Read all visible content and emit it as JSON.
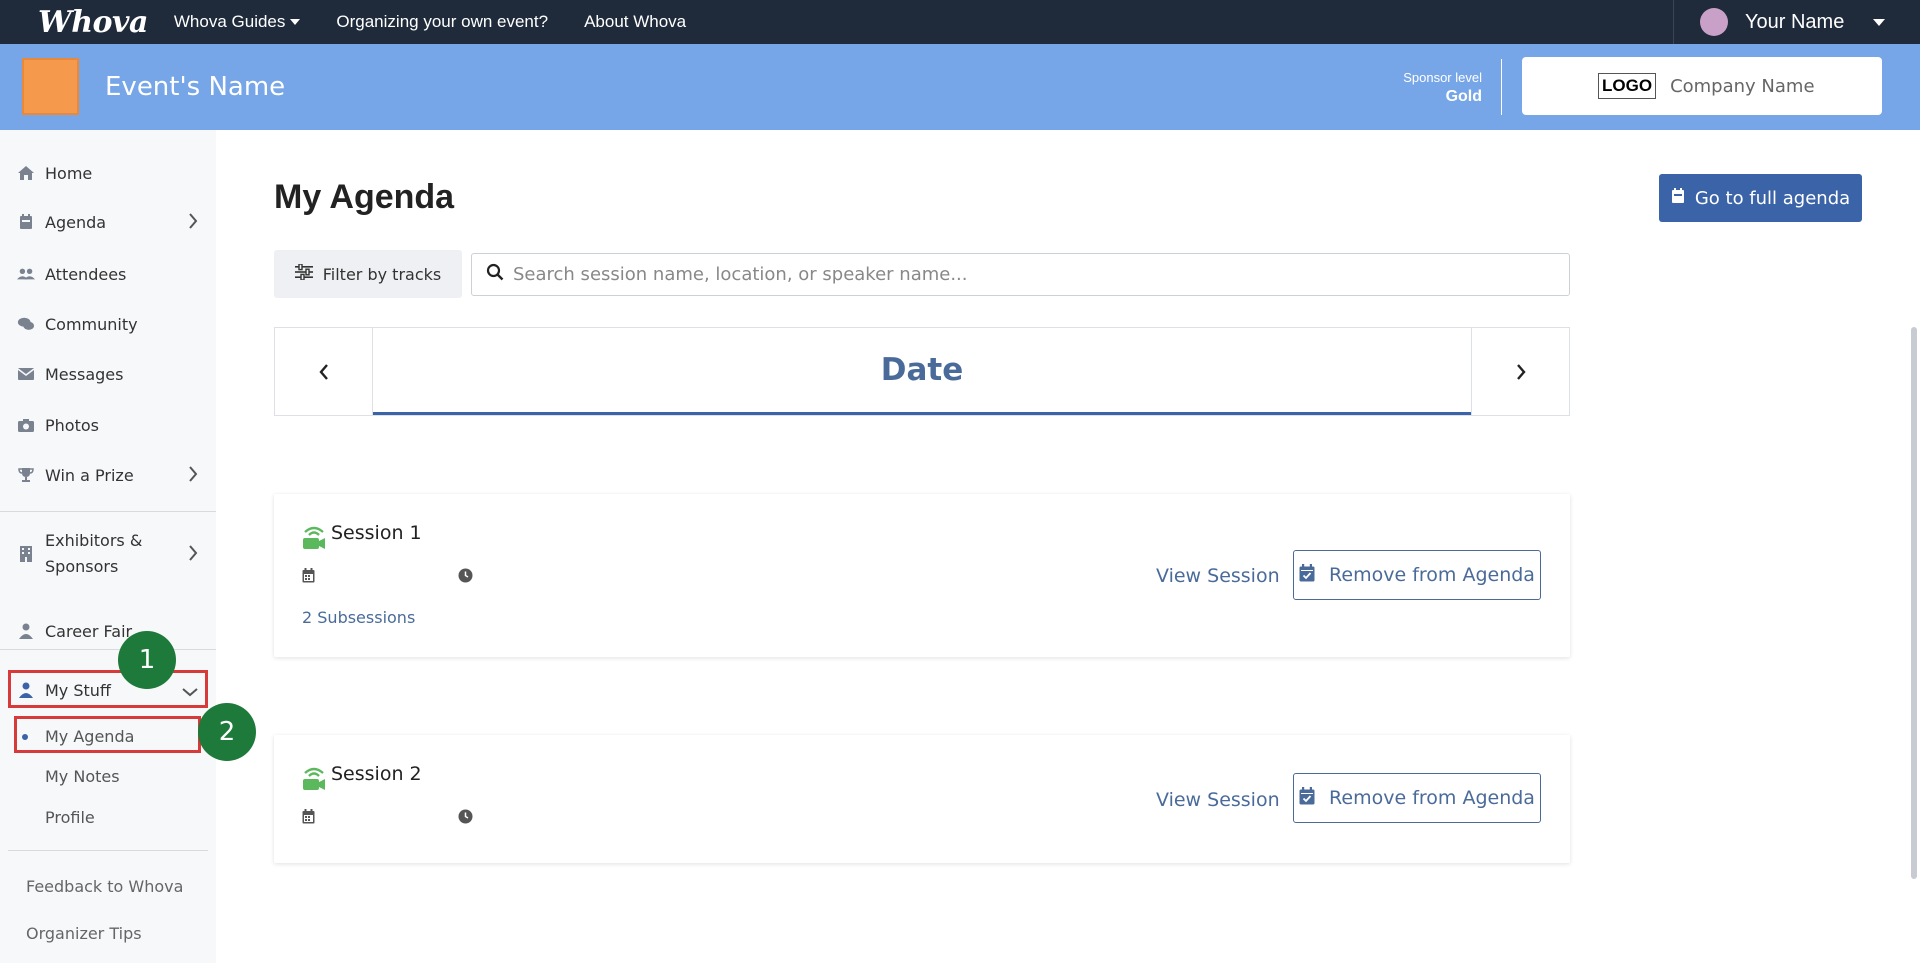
{
  "topnav": {
    "brand": "Whova",
    "links": [
      "Whova Guides",
      "Organizing your own event?",
      "About Whova"
    ],
    "user_name": "Your Name"
  },
  "event": {
    "name": "Event's Name",
    "sponsor_level_label": "Sponsor level",
    "sponsor_tier": "Gold",
    "logo_text": "LOGO",
    "company_name": "Company Name"
  },
  "sidebar": {
    "items": [
      {
        "label": "Home",
        "icon": "home-icon"
      },
      {
        "label": "Agenda",
        "icon": "calendar-icon"
      },
      {
        "label": "Attendees",
        "icon": "users-icon"
      },
      {
        "label": "Community",
        "icon": "chat-icon"
      },
      {
        "label": "Messages",
        "icon": "envelope-icon"
      },
      {
        "label": "Photos",
        "icon": "camera-icon"
      },
      {
        "label": "Win a Prize",
        "icon": "trophy-icon"
      },
      {
        "label": "Exhibitors &",
        "label2": "Sponsors",
        "icon": "building-icon"
      },
      {
        "label": "Career Fair",
        "icon": "person-tie-icon"
      },
      {
        "label": "My Stuff",
        "icon": "person-icon"
      }
    ],
    "my_stuff_sub": [
      "My Agenda",
      "My Notes",
      "Profile"
    ],
    "footer": [
      "Feedback to Whova",
      "Organizer Tips"
    ]
  },
  "annotations": [
    "1",
    "2"
  ],
  "main": {
    "title": "My Agenda",
    "full_agenda_button": "Go to full agenda",
    "filter_button": "Filter by tracks",
    "search_placeholder": "Search session name, location, or speaker name...",
    "date_label": "Date"
  },
  "sessions": [
    {
      "title": "Session 1",
      "subsessions": "2 Subsessions",
      "view": "View Session",
      "remove": "Remove from Agenda"
    },
    {
      "title": "Session 2",
      "view": "View Session",
      "remove": "Remove from Agenda"
    }
  ],
  "colors": {
    "topnav_bg": "#1f2a3a",
    "event_bar": "#76a6e8",
    "accent": "#3a63a8",
    "annotation_red": "#d63a3a",
    "annotation_green": "#1d7a3a"
  }
}
